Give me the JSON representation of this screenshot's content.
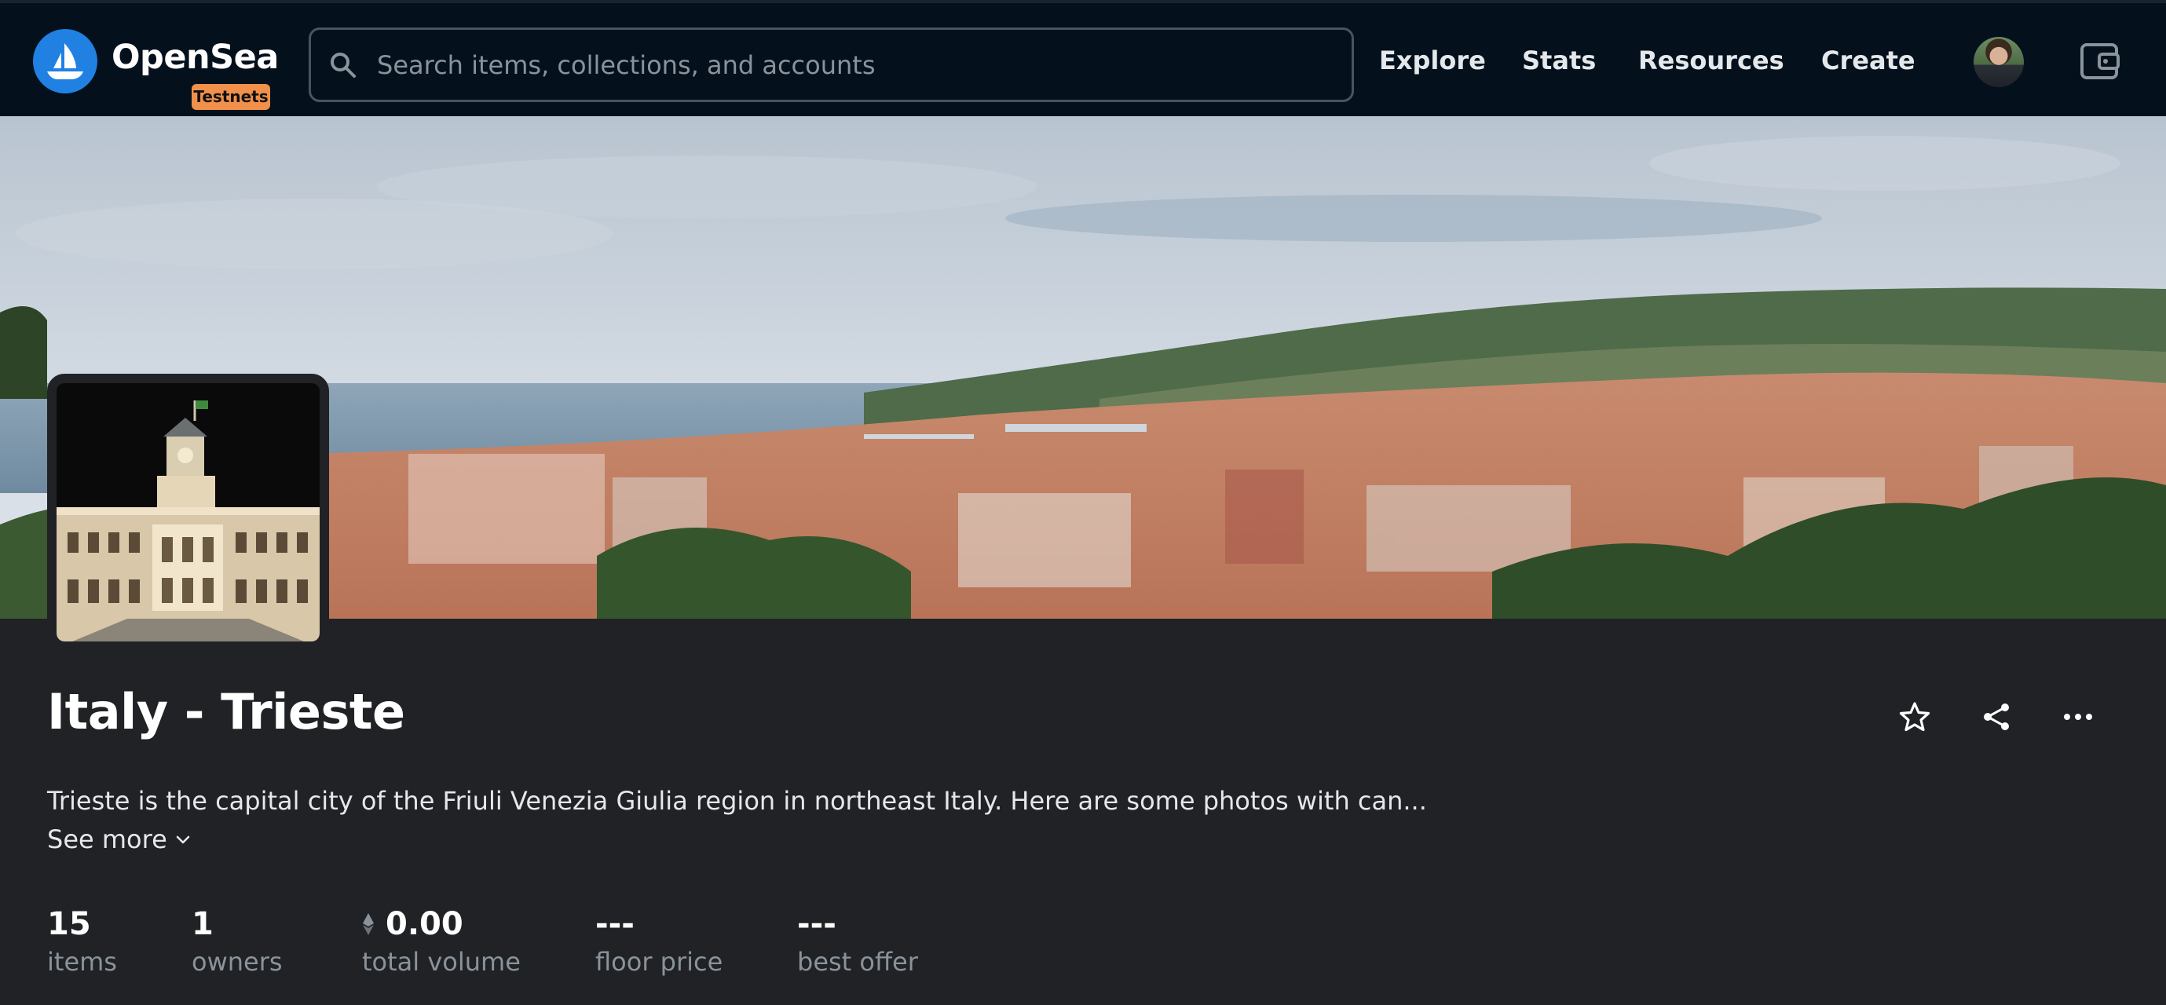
{
  "header": {
    "brand": "OpenSea",
    "badge": "Testnets",
    "search": {
      "placeholder": "Search items, collections, and accounts",
      "value": ""
    },
    "nav": [
      "Explore",
      "Stats",
      "Resources",
      "Create"
    ],
    "icons": [
      "opensea-logo-icon",
      "search-icon",
      "avatar",
      "wallet-icon"
    ]
  },
  "collection": {
    "title": "Italy - Trieste",
    "description": "Trieste is the capital city of the Friuli Venezia Giulia region in northeast Italy. Here are some photos with can...",
    "see_more": "See more",
    "actions": [
      "star-icon",
      "share-icon",
      "more-icon"
    ]
  },
  "stats": [
    {
      "value": "15",
      "label": "items"
    },
    {
      "value": "1",
      "label": "owners"
    },
    {
      "value": "0.00",
      "label": "total volume",
      "icon": "ethereum-icon"
    },
    {
      "value": "---",
      "label": "floor price"
    },
    {
      "value": "---",
      "label": "best offer"
    }
  ],
  "colors": {
    "navbar": "#04111d",
    "page_background": "#202225",
    "accent_blue": "#2081e2",
    "badge_orange": "#f0904a",
    "muted_text": "#8a939b"
  }
}
